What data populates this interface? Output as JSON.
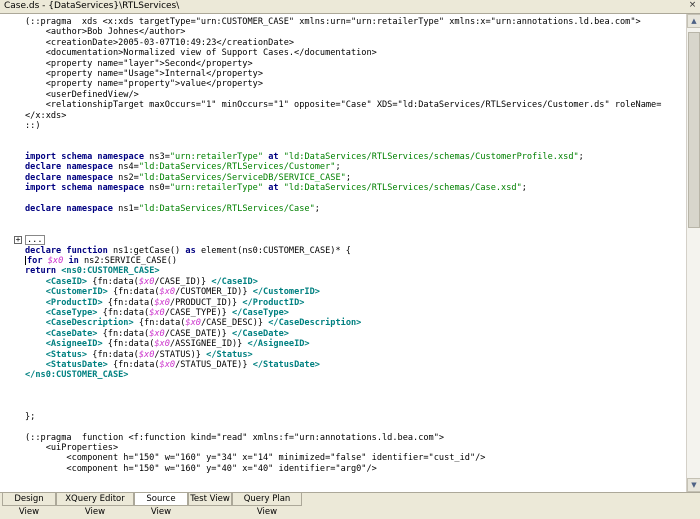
{
  "window": {
    "title": "Case.ds - {DataServices}\\RTLServices\\",
    "close_glyph": "×"
  },
  "fold_marker": "+",
  "fold_text": "...",
  "code_lines": [
    [
      [
        "n",
        "(::pragma  xds <x:xds targetType=\"urn:CUSTOMER_CASE\" xmlns:urn=\"urn:retailerType\" xmlns:x=\"urn:annotations.ld.bea.com\">"
      ]
    ],
    [
      [
        "n",
        "    <author>Bob Johnes</author>"
      ]
    ],
    [
      [
        "n",
        "    <creationDate>2005-03-07T10:49:23</creationDate>"
      ]
    ],
    [
      [
        "n",
        "    <documentation>Normalized view of Support Cases.</documentation>"
      ]
    ],
    [
      [
        "n",
        "    <property name=\"layer\">Second</property>"
      ]
    ],
    [
      [
        "n",
        "    <property name=\"Usage\">Internal</property>"
      ]
    ],
    [
      [
        "n",
        "    <property name=\"property\">value</property>"
      ]
    ],
    [
      [
        "n",
        "    <userDefinedView/>"
      ]
    ],
    [
      [
        "n",
        "    <relationshipTarget maxOccurs=\"1\" minOccurs=\"1\" opposite=\"Case\" XDS=\"ld:DataServices/RTLServices/Customer.ds\" roleName="
      ]
    ],
    [
      [
        "n",
        "</x:xds>"
      ]
    ],
    [
      [
        "n",
        "::)"
      ]
    ],
    [],
    [],
    [
      [
        "k",
        "import schema namespace"
      ],
      [
        "n",
        " ns3="
      ],
      [
        "s",
        "\"urn:retailerType\""
      ],
      [
        "n",
        " "
      ],
      [
        "k",
        "at"
      ],
      [
        "n",
        " "
      ],
      [
        "s",
        "\"ld:DataServices/RTLServices/schemas/CustomerProfile.xsd\""
      ],
      [
        "n",
        ";"
      ]
    ],
    [
      [
        "k",
        "declare namespace"
      ],
      [
        "n",
        " ns4="
      ],
      [
        "s",
        "\"ld:DataServices/RTLServices/Customer\""
      ],
      [
        "n",
        ";"
      ]
    ],
    [
      [
        "k",
        "declare namespace"
      ],
      [
        "n",
        " ns2="
      ],
      [
        "s",
        "\"ld:DataServices/ServiceDB/SERVICE_CASE\""
      ],
      [
        "n",
        ";"
      ]
    ],
    [
      [
        "k",
        "import schema namespace"
      ],
      [
        "n",
        " ns0="
      ],
      [
        "s",
        "\"urn:retailerType\""
      ],
      [
        "n",
        " "
      ],
      [
        "k",
        "at"
      ],
      [
        "n",
        " "
      ],
      [
        "s",
        "\"ld:DataServices/RTLServices/schemas/Case.xsd\""
      ],
      [
        "n",
        ";"
      ]
    ],
    [],
    [
      [
        "k",
        "declare namespace"
      ],
      [
        "n",
        " ns1="
      ],
      [
        "s",
        "\"ld:DataServices/RTLServices/Case\""
      ],
      [
        "n",
        ";"
      ]
    ],
    [],
    [],
    [
      [
        "fold",
        "..."
      ]
    ],
    [
      [
        "k",
        "declare function"
      ],
      [
        "n",
        " ns1:getCase() "
      ],
      [
        "k",
        "as"
      ],
      [
        "n",
        " element(ns0:CUSTOMER_CASE)* {"
      ]
    ],
    [
      [
        "caret",
        ""
      ],
      [
        "k",
        "for"
      ],
      [
        "n",
        " "
      ],
      [
        "v",
        "$x0"
      ],
      [
        "n",
        " "
      ],
      [
        "k",
        "in"
      ],
      [
        "n",
        " ns2:SERVICE_CASE()"
      ]
    ],
    [
      [
        "k",
        "return"
      ],
      [
        "n",
        " "
      ],
      [
        "t",
        "<ns0:CUSTOMER_CASE>"
      ]
    ],
    [
      [
        "n",
        "    "
      ],
      [
        "t",
        "<CaseID>"
      ],
      [
        "n",
        " {fn:data("
      ],
      [
        "v",
        "$x0"
      ],
      [
        "n",
        "/CASE_ID)} "
      ],
      [
        "t",
        "</CaseID>"
      ]
    ],
    [
      [
        "n",
        "    "
      ],
      [
        "t",
        "<CustomerID>"
      ],
      [
        "n",
        " {fn:data("
      ],
      [
        "v",
        "$x0"
      ],
      [
        "n",
        "/CUSTOMER_ID)} "
      ],
      [
        "t",
        "</CustomerID>"
      ]
    ],
    [
      [
        "n",
        "    "
      ],
      [
        "t",
        "<ProductID>"
      ],
      [
        "n",
        " {fn:data("
      ],
      [
        "v",
        "$x0"
      ],
      [
        "n",
        "/PRODUCT_ID)} "
      ],
      [
        "t",
        "</ProductID>"
      ]
    ],
    [
      [
        "n",
        "    "
      ],
      [
        "t",
        "<CaseType>"
      ],
      [
        "n",
        " {fn:data("
      ],
      [
        "v",
        "$x0"
      ],
      [
        "n",
        "/CASE_TYPE)} "
      ],
      [
        "t",
        "</CaseType>"
      ]
    ],
    [
      [
        "n",
        "    "
      ],
      [
        "t",
        "<CaseDescription>"
      ],
      [
        "n",
        " {fn:data("
      ],
      [
        "v",
        "$x0"
      ],
      [
        "n",
        "/CASE_DESC)} "
      ],
      [
        "t",
        "</CaseDescription>"
      ]
    ],
    [
      [
        "n",
        "    "
      ],
      [
        "t",
        "<CaseDate>"
      ],
      [
        "n",
        " {fn:data("
      ],
      [
        "v",
        "$x0"
      ],
      [
        "n",
        "/CASE_DATE)} "
      ],
      [
        "t",
        "</CaseDate>"
      ]
    ],
    [
      [
        "n",
        "    "
      ],
      [
        "t",
        "<AsigneeID>"
      ],
      [
        "n",
        " {fn:data("
      ],
      [
        "v",
        "$x0"
      ],
      [
        "n",
        "/ASSIGNEE_ID)} "
      ],
      [
        "t",
        "</AsigneeID>"
      ]
    ],
    [
      [
        "n",
        "    "
      ],
      [
        "t",
        "<Status>"
      ],
      [
        "n",
        " {fn:data("
      ],
      [
        "v",
        "$x0"
      ],
      [
        "n",
        "/STATUS)} "
      ],
      [
        "t",
        "</Status>"
      ]
    ],
    [
      [
        "n",
        "    "
      ],
      [
        "t",
        "<StatusDate>"
      ],
      [
        "n",
        " {fn:data("
      ],
      [
        "v",
        "$x0"
      ],
      [
        "n",
        "/STATUS_DATE)} "
      ],
      [
        "t",
        "</StatusDate>"
      ]
    ],
    [
      [
        "t",
        "</ns0:CUSTOMER_CASE>"
      ]
    ],
    [],
    [],
    [],
    [
      [
        "n",
        "};"
      ]
    ],
    [],
    [
      [
        "n",
        "(::pragma  function <f:function kind=\"read\" xmlns:f=\"urn:annotations.ld.bea.com\">"
      ]
    ],
    [
      [
        "n",
        "    <uiProperties>"
      ]
    ],
    [
      [
        "n",
        "        <component h=\"150\" w=\"160\" y=\"34\" x=\"14\" minimized=\"false\" identifier=\"cust_id\"/>"
      ]
    ],
    [
      [
        "n",
        "        <component h=\"150\" w=\"160\" y=\"40\" x=\"40\" identifier=\"arg0\"/>"
      ]
    ]
  ],
  "scrollbar": {
    "up_glyph": "▲",
    "down_glyph": "▼"
  },
  "tabs": [
    {
      "label": "Design View",
      "active": false
    },
    {
      "label": "XQuery Editor View",
      "active": false
    },
    {
      "label": "Source View",
      "active": true
    },
    {
      "label": "Test View",
      "active": false
    },
    {
      "label": "Query Plan View",
      "active": false
    }
  ],
  "colors": {
    "keyword": "#000080",
    "string": "#008000",
    "tag": "#008080",
    "variable": "#cc33cc"
  }
}
